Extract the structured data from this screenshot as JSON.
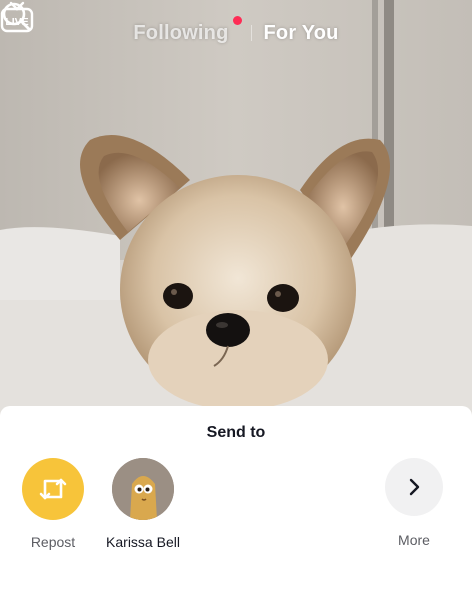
{
  "header": {
    "live_label": "LIVE",
    "tabs": [
      {
        "label": "Following",
        "active": false,
        "has_notification": true
      },
      {
        "label": "For You",
        "active": true
      }
    ],
    "icons": {
      "live": "live-tv-icon",
      "search": "search-icon"
    }
  },
  "video": {
    "subject": "dog-video",
    "background_color": "#d6d2cc"
  },
  "share_sheet": {
    "title": "Send to",
    "targets": [
      {
        "label": "Repost",
        "icon": "repost-icon",
        "color": "#f7c43a"
      },
      {
        "label": "Karissa Bell",
        "icon": "avatar"
      },
      {
        "label": "More",
        "icon": "chevron-right-icon",
        "color": "#f1f1f2"
      }
    ]
  },
  "colors": {
    "notification_dot": "#fe2c55",
    "text_primary": "#161823",
    "text_secondary": "#5c5d63"
  }
}
